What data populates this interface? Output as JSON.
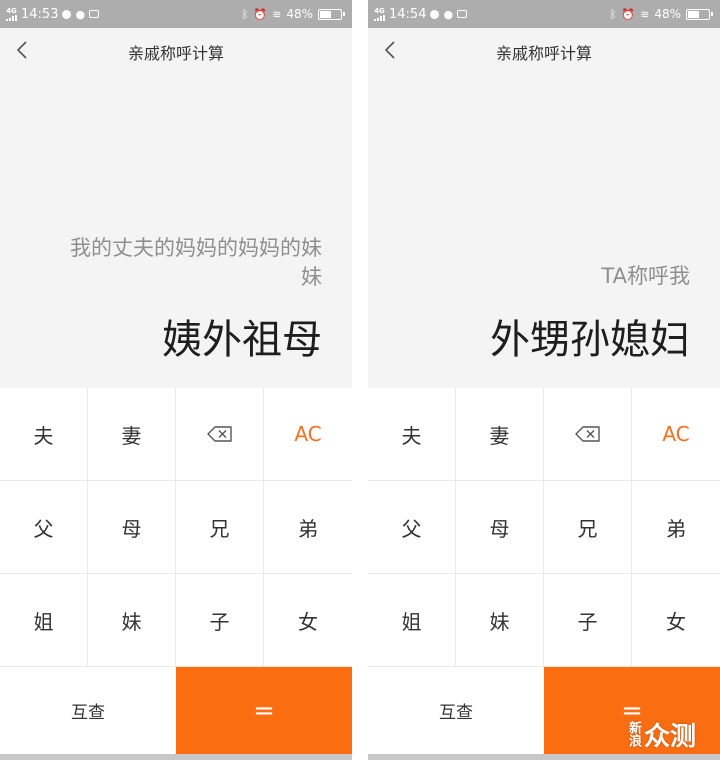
{
  "left": {
    "status": {
      "network": "4G",
      "time": "14:53",
      "battery": "48%",
      "battery_level": 0.48
    },
    "title": "亲戚称呼计算",
    "expression": "我的丈夫的妈妈的妈妈的妹\n妹",
    "result": "姨外祖母",
    "keys": [
      "夫",
      "妻",
      "AC",
      "父",
      "母",
      "兄",
      "弟",
      "姐",
      "妹",
      "子",
      "女"
    ],
    "mutual_label": "互查",
    "equals_label": "="
  },
  "right": {
    "status": {
      "network": "4G",
      "time": "14:54",
      "battery": "48%",
      "battery_level": 0.48
    },
    "title": "亲戚称呼计算",
    "expression": "TA称呼我",
    "result": "外甥孙媳妇",
    "keys": [
      "夫",
      "妻",
      "AC",
      "父",
      "母",
      "兄",
      "弟",
      "姐",
      "妹",
      "子",
      "女"
    ],
    "mutual_label": "互查",
    "equals_label": "="
  },
  "watermark": {
    "seal": "新浪",
    "text": "众测"
  },
  "colors": {
    "accent": "#fb6d11",
    "ac_text": "#f37021",
    "status_bar": "#adadad",
    "display_bg": "#f5f4f5"
  },
  "icons": {
    "back": "chevron-left-icon",
    "delete": "backspace-icon"
  }
}
